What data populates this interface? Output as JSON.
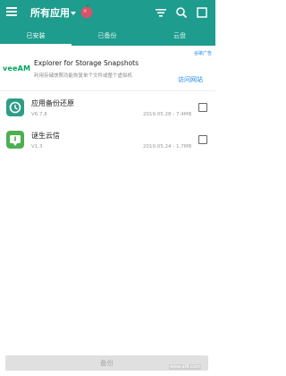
{
  "appbar": {
    "title": "所有应用",
    "icons": [
      "menu-icon",
      "dropdown-caret-icon",
      "apple-logo-icon",
      "filter-icon",
      "search-icon",
      "select-all-icon"
    ],
    "bg_color": "#1e9c8e"
  },
  "tabs": [
    {
      "label": "已安装",
      "active": true
    },
    {
      "label": "已备份",
      "active": false
    },
    {
      "label": "云盘",
      "active": false
    }
  ],
  "ad": {
    "tag": "谷歌广告",
    "logo": "veeAM",
    "title": "Explorer for Storage Snapshots",
    "subtitle": "利用存储快照功能恢复单个文件或整个虚拟机",
    "link": "访问网站",
    "link_color": "#1e88e5"
  },
  "apps": [
    {
      "name": "应用备份还原",
      "version": "V6.7.8",
      "meta": "2019.05.28 - 7.4MB",
      "icon": "backup-restore-icon",
      "icon_color": "#2e9d86",
      "checked": false
    },
    {
      "name": "谜生云信",
      "version": "V1.3",
      "meta": "2019.05.24 - 1.7MB",
      "icon": "download-app-icon",
      "icon_color": "#4caf50",
      "checked": false
    }
  ],
  "footer": {
    "backup_label": "备份",
    "watermark": "www.qt6.com"
  }
}
